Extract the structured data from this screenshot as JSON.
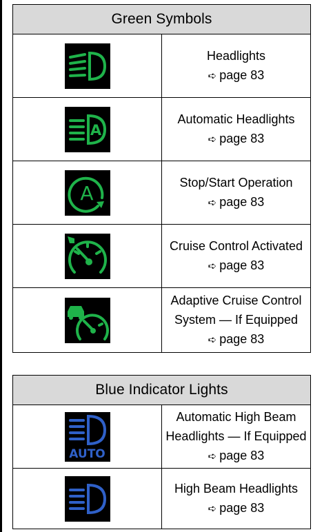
{
  "green": {
    "title": "Green Symbols",
    "rows": [
      {
        "label": "Headlights",
        "ref": "page 83",
        "icon": "headlights-icon"
      },
      {
        "label": "Automatic Headlights",
        "ref": "page 83",
        "icon": "automatic-headlights-icon"
      },
      {
        "label": "Stop/Start Operation",
        "ref": "page 83",
        "icon": "stop-start-icon"
      },
      {
        "label": "Cruise Control Activated",
        "ref": "page 83",
        "icon": "cruise-control-icon"
      },
      {
        "label_line1": "Adaptive Cruise Control",
        "label_line2": "System — If Equipped",
        "ref": "page 83",
        "icon": "adaptive-cruise-control-icon"
      }
    ]
  },
  "blue": {
    "title": "Blue Indicator Lights",
    "rows": [
      {
        "label_line1": "Automatic High Beam",
        "label_line2": "Headlights — If Equipped",
        "ref": "page 83",
        "icon": "automatic-high-beam-icon",
        "icon_text": "AUTO"
      },
      {
        "label": "High Beam Headlights",
        "ref": "page 83",
        "icon": "high-beam-icon"
      }
    ]
  },
  "ref_arrow": "➪",
  "colors": {
    "green": "#1fb34a",
    "blue": "#2f60c8",
    "header_bg": "#d9d9d9"
  }
}
